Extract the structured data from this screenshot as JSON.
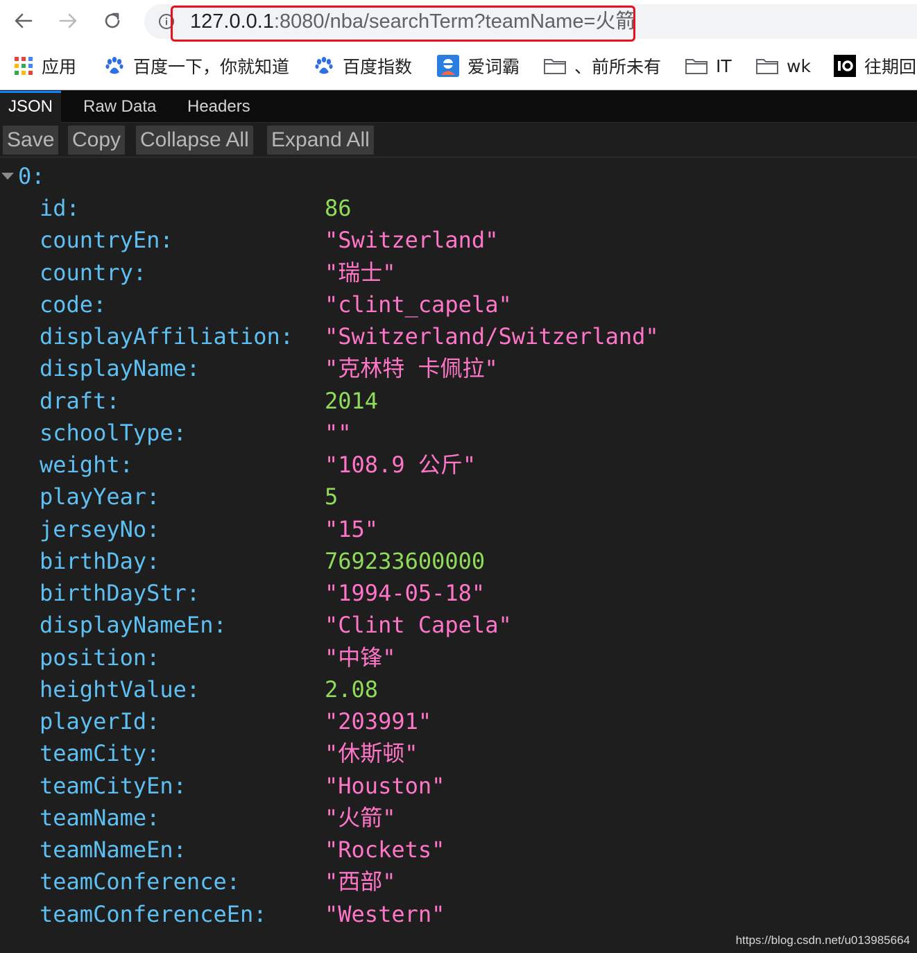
{
  "browser": {
    "url_host": "127.0.0.1",
    "url_rest": ":8080/nba/searchTerm?teamName=火箭",
    "bookmarks": [
      {
        "label": "应用",
        "icon": "apps-grid-icon"
      },
      {
        "label": "百度一下，你就知道",
        "icon": "baidu-paw-icon"
      },
      {
        "label": "百度指数",
        "icon": "baidu-paw-icon"
      },
      {
        "label": "爱词霸",
        "icon": "iciba-icon"
      },
      {
        "label": "、前所未有",
        "icon": "folder-icon"
      },
      {
        "label": "IT",
        "icon": "folder-icon"
      },
      {
        "label": "wk",
        "icon": "folder-icon"
      },
      {
        "label": "往期回",
        "icon": "io-icon"
      }
    ]
  },
  "viewer": {
    "tabs": [
      "JSON",
      "Raw Data",
      "Headers"
    ],
    "active_tab": "JSON",
    "toolbar": [
      "Save",
      "Copy",
      "Collapse All",
      "Expand All"
    ],
    "root_key": "0:",
    "fields": [
      {
        "key": "id:",
        "value": "86",
        "type": "num"
      },
      {
        "key": "countryEn:",
        "value": "\"Switzerland\"",
        "type": "str"
      },
      {
        "key": "country:",
        "value": "\"瑞士\"",
        "type": "str"
      },
      {
        "key": "code:",
        "value": "\"clint_capela\"",
        "type": "str"
      },
      {
        "key": "displayAffiliation:",
        "value": "\"Switzerland/Switzerland\"",
        "type": "str"
      },
      {
        "key": "displayName:",
        "value": "\"克林特 卡佩拉\"",
        "type": "str"
      },
      {
        "key": "draft:",
        "value": "2014",
        "type": "num"
      },
      {
        "key": "schoolType:",
        "value": "\"\"",
        "type": "str"
      },
      {
        "key": "weight:",
        "value": "\"108.9 公斤\"",
        "type": "str"
      },
      {
        "key": "playYear:",
        "value": "5",
        "type": "num"
      },
      {
        "key": "jerseyNo:",
        "value": "\"15\"",
        "type": "str"
      },
      {
        "key": "birthDay:",
        "value": "769233600000",
        "type": "num"
      },
      {
        "key": "birthDayStr:",
        "value": "\"1994-05-18\"",
        "type": "str"
      },
      {
        "key": "displayNameEn:",
        "value": "\"Clint Capela\"",
        "type": "str"
      },
      {
        "key": "position:",
        "value": "\"中锋\"",
        "type": "str"
      },
      {
        "key": "heightValue:",
        "value": "2.08",
        "type": "num"
      },
      {
        "key": "playerId:",
        "value": "\"203991\"",
        "type": "str"
      },
      {
        "key": "teamCity:",
        "value": "\"休斯顿\"",
        "type": "str"
      },
      {
        "key": "teamCityEn:",
        "value": "\"Houston\"",
        "type": "str"
      },
      {
        "key": "teamName:",
        "value": "\"火箭\"",
        "type": "str"
      },
      {
        "key": "teamNameEn:",
        "value": "\"Rockets\"",
        "type": "str"
      },
      {
        "key": "teamConference:",
        "value": "\"西部\"",
        "type": "str"
      },
      {
        "key": "teamConferenceEn:",
        "value": "\"Western\"",
        "type": "str"
      }
    ]
  },
  "watermark": "https://blog.csdn.net/u013985664",
  "colors": {
    "key": "#5ec0f2",
    "string": "#ff76c8",
    "number": "#8fdc5a",
    "highlight": "#e8101c"
  }
}
